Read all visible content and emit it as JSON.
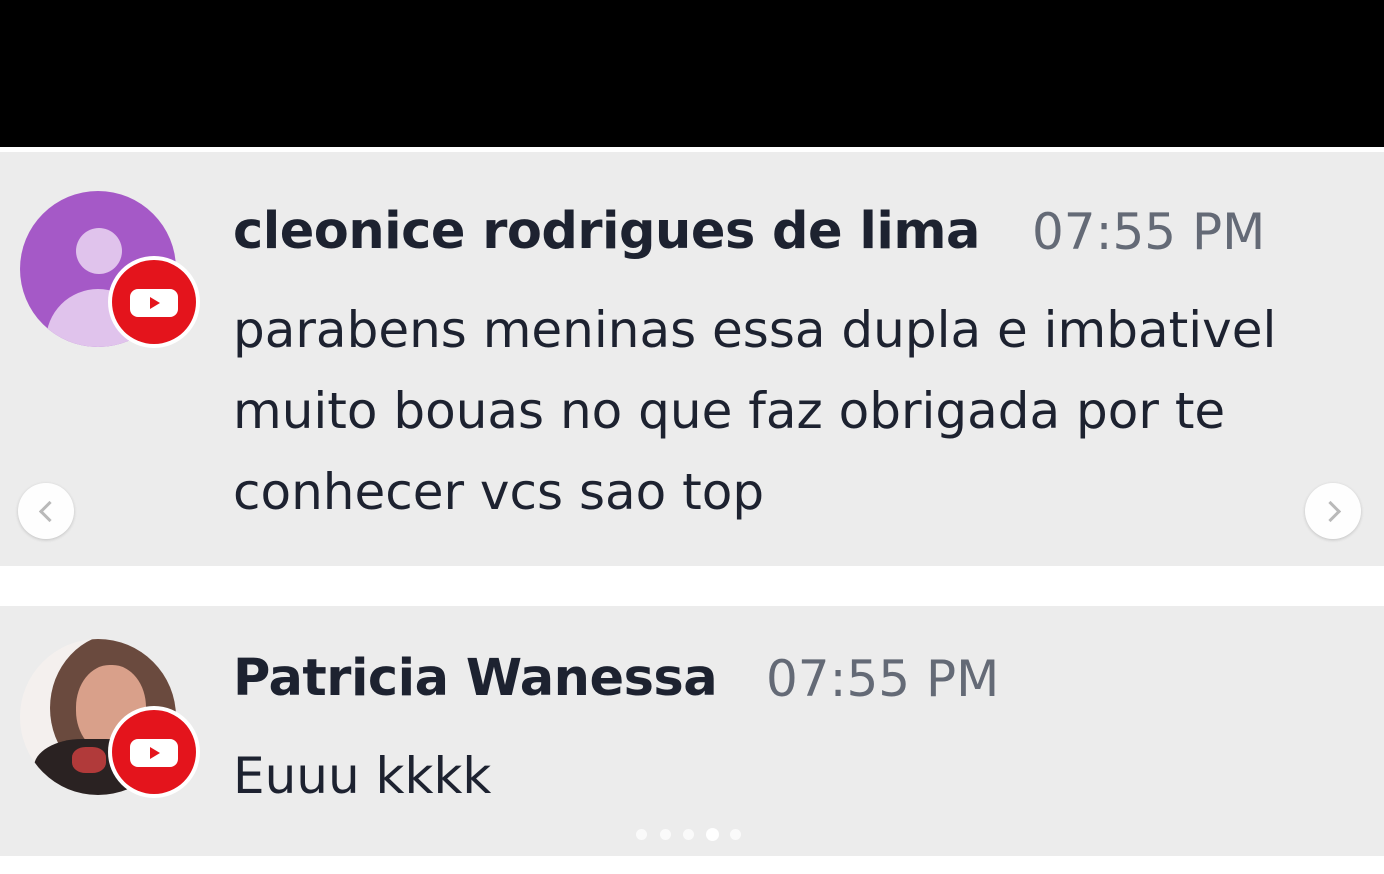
{
  "comments": [
    {
      "author": "cleonice rodrigues de lima",
      "time": "07:55 PM",
      "text_lines": [
        "parabens meninas essa dupla e imbativel",
        "muito bouas no que faz obrigada por te",
        "conhecer vcs sao top"
      ],
      "avatar": "default-user-icon",
      "badge": "youtube-icon"
    },
    {
      "author": "Patricia Wanessa",
      "time": "07:55 PM",
      "text_lines": [
        "Euuu kkkk"
      ],
      "avatar": "user-photo",
      "badge": "youtube-icon"
    }
  ],
  "carousel": {
    "slide_count": 5,
    "active_index": 3,
    "prev_icon": "chevron-left-icon",
    "next_icon": "chevron-right-icon"
  },
  "colors": {
    "background": "#ececec",
    "top_bar": "#000000",
    "author_text": "#1d2230",
    "time_text": "#646a76",
    "youtube_red": "#e4141c",
    "avatar_purple": "#a559c7"
  }
}
